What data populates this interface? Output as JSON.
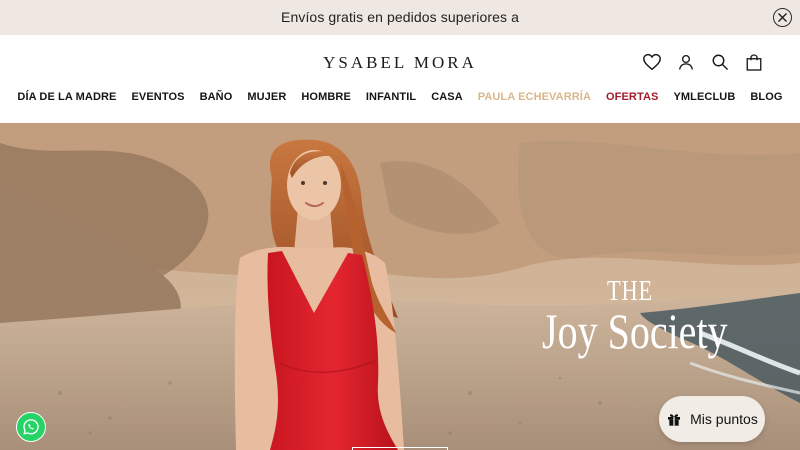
{
  "announcement": {
    "text": "Envíos gratis en pedidos superiores a",
    "close_icon": "close-icon"
  },
  "header": {
    "logo": "YSABEL MORA",
    "icons": [
      "heart-icon",
      "account-icon",
      "search-icon",
      "bag-icon"
    ]
  },
  "nav": {
    "items": [
      {
        "label": "DÍA DE LA MADRE"
      },
      {
        "label": "EVENTOS"
      },
      {
        "label": "BAÑO"
      },
      {
        "label": "MUJER"
      },
      {
        "label": "HOMBRE"
      },
      {
        "label": "INFANTIL"
      },
      {
        "label": "CASA"
      },
      {
        "label": "PAULA ECHEVARRÍA"
      },
      {
        "label": "OFERTAS"
      },
      {
        "label": "YMLECLUB"
      },
      {
        "label": "BLOG"
      }
    ],
    "colors": {
      "default": "#151515",
      "highlight": "#d9b68b",
      "sale": "#a11c2c"
    }
  },
  "hero": {
    "title_small": "THE",
    "title_big": "Joy Society"
  },
  "widgets": {
    "whatsapp_icon": "whatsapp-icon",
    "points_label": "Mis puntos",
    "points_icon": "gift-icon",
    "whatsapp_color": "#25d366"
  }
}
